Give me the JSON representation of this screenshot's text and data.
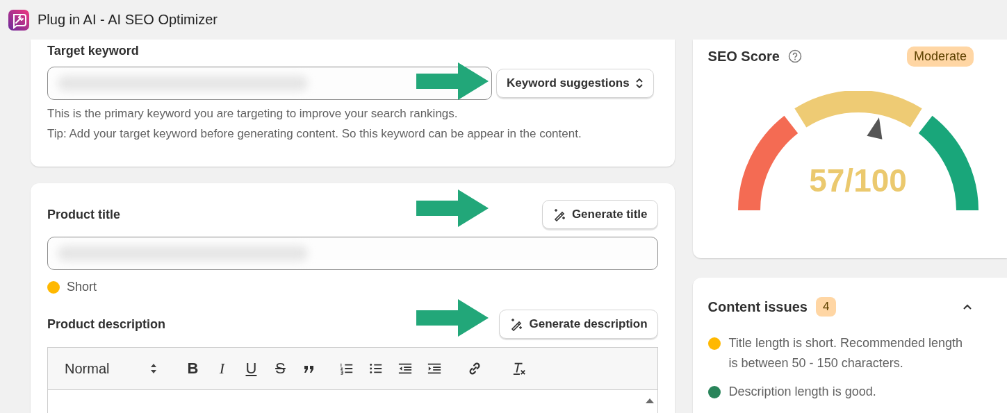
{
  "window": {
    "title": "Plug in AI - AI SEO Optimizer"
  },
  "target_keyword": {
    "label": "Target keyword",
    "button": "Keyword suggestions",
    "help": [
      "This is the primary keyword you are targeting to improve your search rankings.",
      "Tip: Add your target keyword before generating content. So this keyword can be appear in the content."
    ]
  },
  "product_title": {
    "label": "Product title",
    "button": "Generate title",
    "status": {
      "text": "Short",
      "color": "#ffb800"
    }
  },
  "product_description": {
    "label": "Product description",
    "button": "Generate description",
    "editor": {
      "format": "Normal",
      "tools": [
        {
          "kind": "bold",
          "glyph": "B"
        },
        {
          "kind": "italic",
          "glyph": "I"
        },
        {
          "kind": "underline",
          "glyph": "U"
        },
        {
          "kind": "strike",
          "glyph": "S"
        },
        {
          "kind": "quote"
        },
        {
          "kind": "ordered-list"
        },
        {
          "kind": "bullet-list"
        },
        {
          "kind": "outdent"
        },
        {
          "kind": "indent"
        },
        {
          "kind": "link"
        },
        {
          "kind": "clear-format"
        }
      ]
    }
  },
  "seo_score": {
    "title": "SEO Score",
    "badge": "Moderate",
    "score": "57/100",
    "level": 0.57
  },
  "content_issues": {
    "title": "Content issues",
    "count": "4",
    "expanded": true,
    "items": [
      {
        "text": "Title length is short. Recommended length is between 50 - 150 characters.",
        "color": "#ffb800"
      },
      {
        "text": "Description length is good.",
        "color": "#29845a"
      }
    ]
  }
}
